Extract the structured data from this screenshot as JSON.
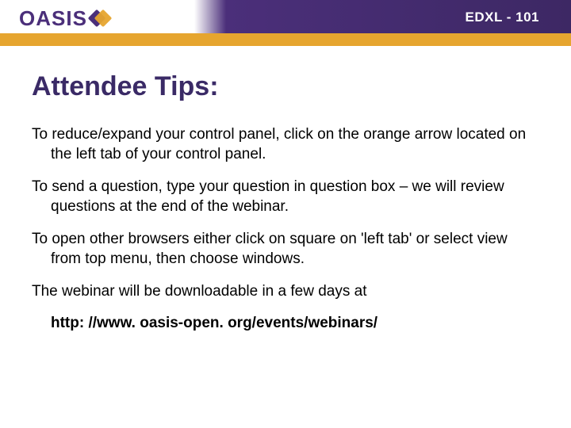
{
  "header": {
    "label": "EDXL - 101",
    "logo_text": "OASIS"
  },
  "title": "Attendee Tips:",
  "tips": [
    "To reduce/expand your control panel, click on the orange arrow located on the left tab of your control panel.",
    "To send a question, type your question in question box – we will review questions at the end of the webinar.",
    "To open other browsers either click on square on 'left tab' or select view from top menu, then choose windows.",
    "The webinar will be downloadable in a few days at"
  ],
  "url": "http: //www. oasis-open. org/events/webinars/"
}
